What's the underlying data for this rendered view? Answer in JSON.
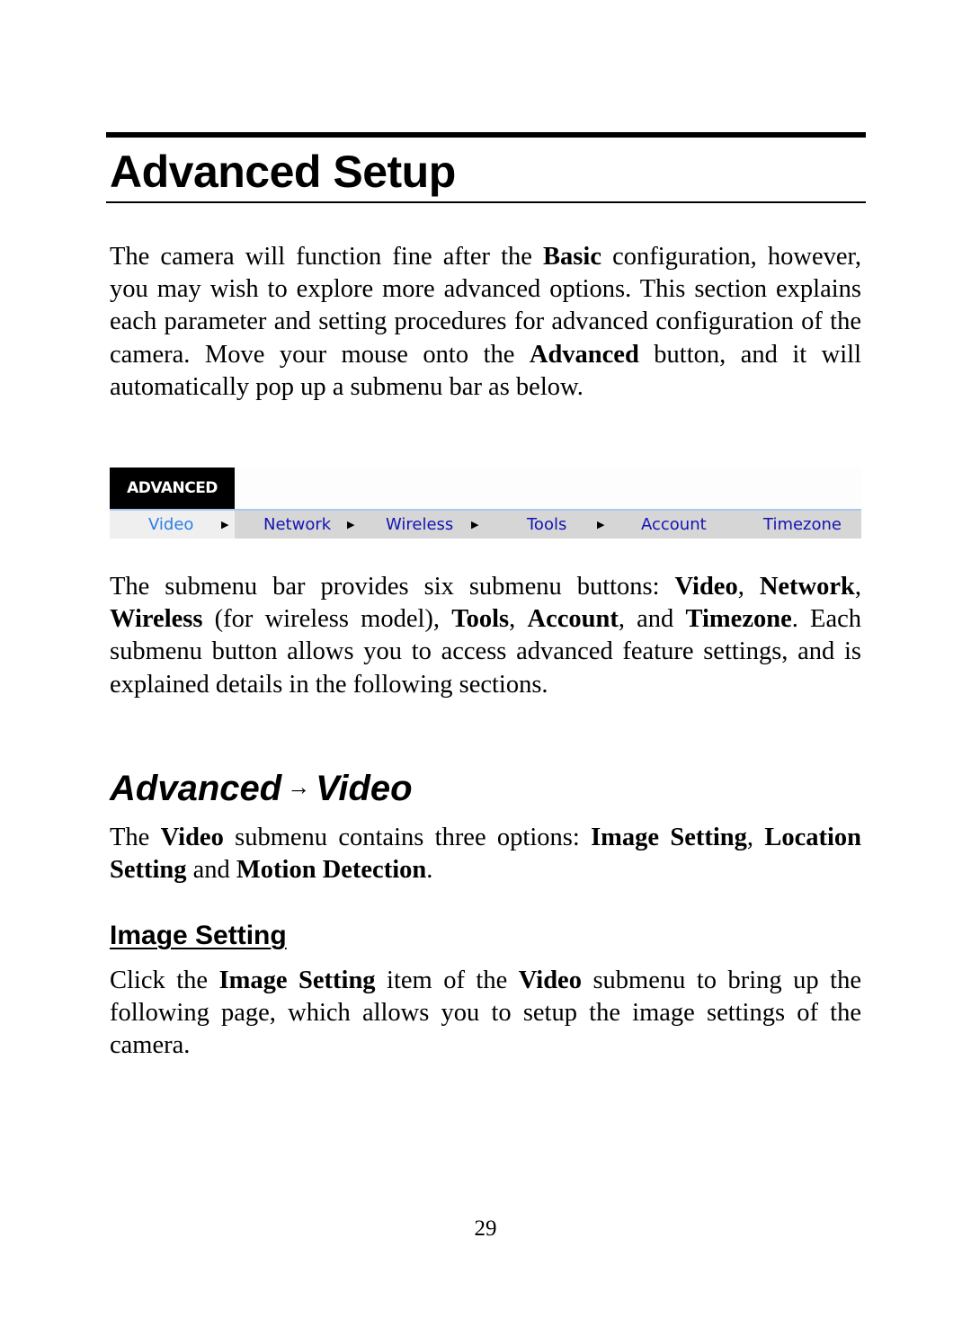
{
  "heading": "Advanced Setup",
  "intro": {
    "parts": [
      {
        "t": "The camera will function fine after the ",
        "b": false
      },
      {
        "t": "Basic",
        "b": true
      },
      {
        "t": " configuration, however, you may wish to explore more advanced options.  This section explains each parameter and setting procedures for advanced configuration of the camera.  Move your mouse onto the ",
        "b": false
      },
      {
        "t": "Advanced",
        "b": true
      },
      {
        "t": " button, and it will automatically pop up a submenu bar as below.",
        "b": false
      }
    ]
  },
  "menu": {
    "tab_label": "ADVANCED",
    "items": [
      {
        "label": "Video",
        "has_arrow": true,
        "active": true
      },
      {
        "label": "Network",
        "has_arrow": true,
        "active": false
      },
      {
        "label": "Wireless",
        "has_arrow": true,
        "active": false
      },
      {
        "label": "Tools",
        "has_arrow": true,
        "active": false
      },
      {
        "label": "Account",
        "has_arrow": false,
        "active": false
      },
      {
        "label": "Timezone",
        "has_arrow": false,
        "active": false
      }
    ],
    "arrow_glyph": "▶",
    "colors": {
      "tab_bg": "#000000",
      "bar_bg": "#d6d6d6",
      "active_bg": "#efefef",
      "link": "#1414b4",
      "active_link": "#2c7ee6",
      "bar_border": "#a9c8ec"
    }
  },
  "submenu_paragraph": {
    "parts": [
      {
        "t": "The submenu bar provides six submenu buttons: ",
        "b": false
      },
      {
        "t": "Video",
        "b": true
      },
      {
        "t": ", ",
        "b": false
      },
      {
        "t": "Network",
        "b": true
      },
      {
        "t": ", ",
        "b": false
      },
      {
        "t": "Wireless",
        "b": true
      },
      {
        "t": " (for wireless model), ",
        "b": false
      },
      {
        "t": "Tools",
        "b": true
      },
      {
        "t": ", ",
        "b": false
      },
      {
        "t": "Account",
        "b": true
      },
      {
        "t": ", and ",
        "b": false
      },
      {
        "t": "Timezone",
        "b": true
      },
      {
        "t": ". Each submenu button allows you to access advanced feature settings, and is explained details in the following sections.",
        "b": false
      }
    ]
  },
  "section": {
    "title_left": "Advanced",
    "title_arrow": "→",
    "title_right": "Video",
    "paragraph": {
      "parts": [
        {
          "t": "The ",
          "b": false
        },
        {
          "t": "Video",
          "b": true
        },
        {
          "t": " submenu contains three options: ",
          "b": false
        },
        {
          "t": "Image Setting",
          "b": true
        },
        {
          "t": ", ",
          "b": false
        },
        {
          "t": "Location Setting",
          "b": true
        },
        {
          "t": " and ",
          "b": false
        },
        {
          "t": "Motion Detection",
          "b": true
        },
        {
          "t": ".",
          "b": false
        }
      ]
    }
  },
  "subsection": {
    "title": "Image Setting",
    "paragraph": {
      "parts": [
        {
          "t": "Click the ",
          "b": false
        },
        {
          "t": "Image Setting",
          "b": true
        },
        {
          "t": " item of the ",
          "b": false
        },
        {
          "t": "Video",
          "b": true
        },
        {
          "t": " submenu to bring up the following page, which allows you to setup the image settings of the camera.",
          "b": false
        }
      ]
    }
  },
  "page_number": "29"
}
